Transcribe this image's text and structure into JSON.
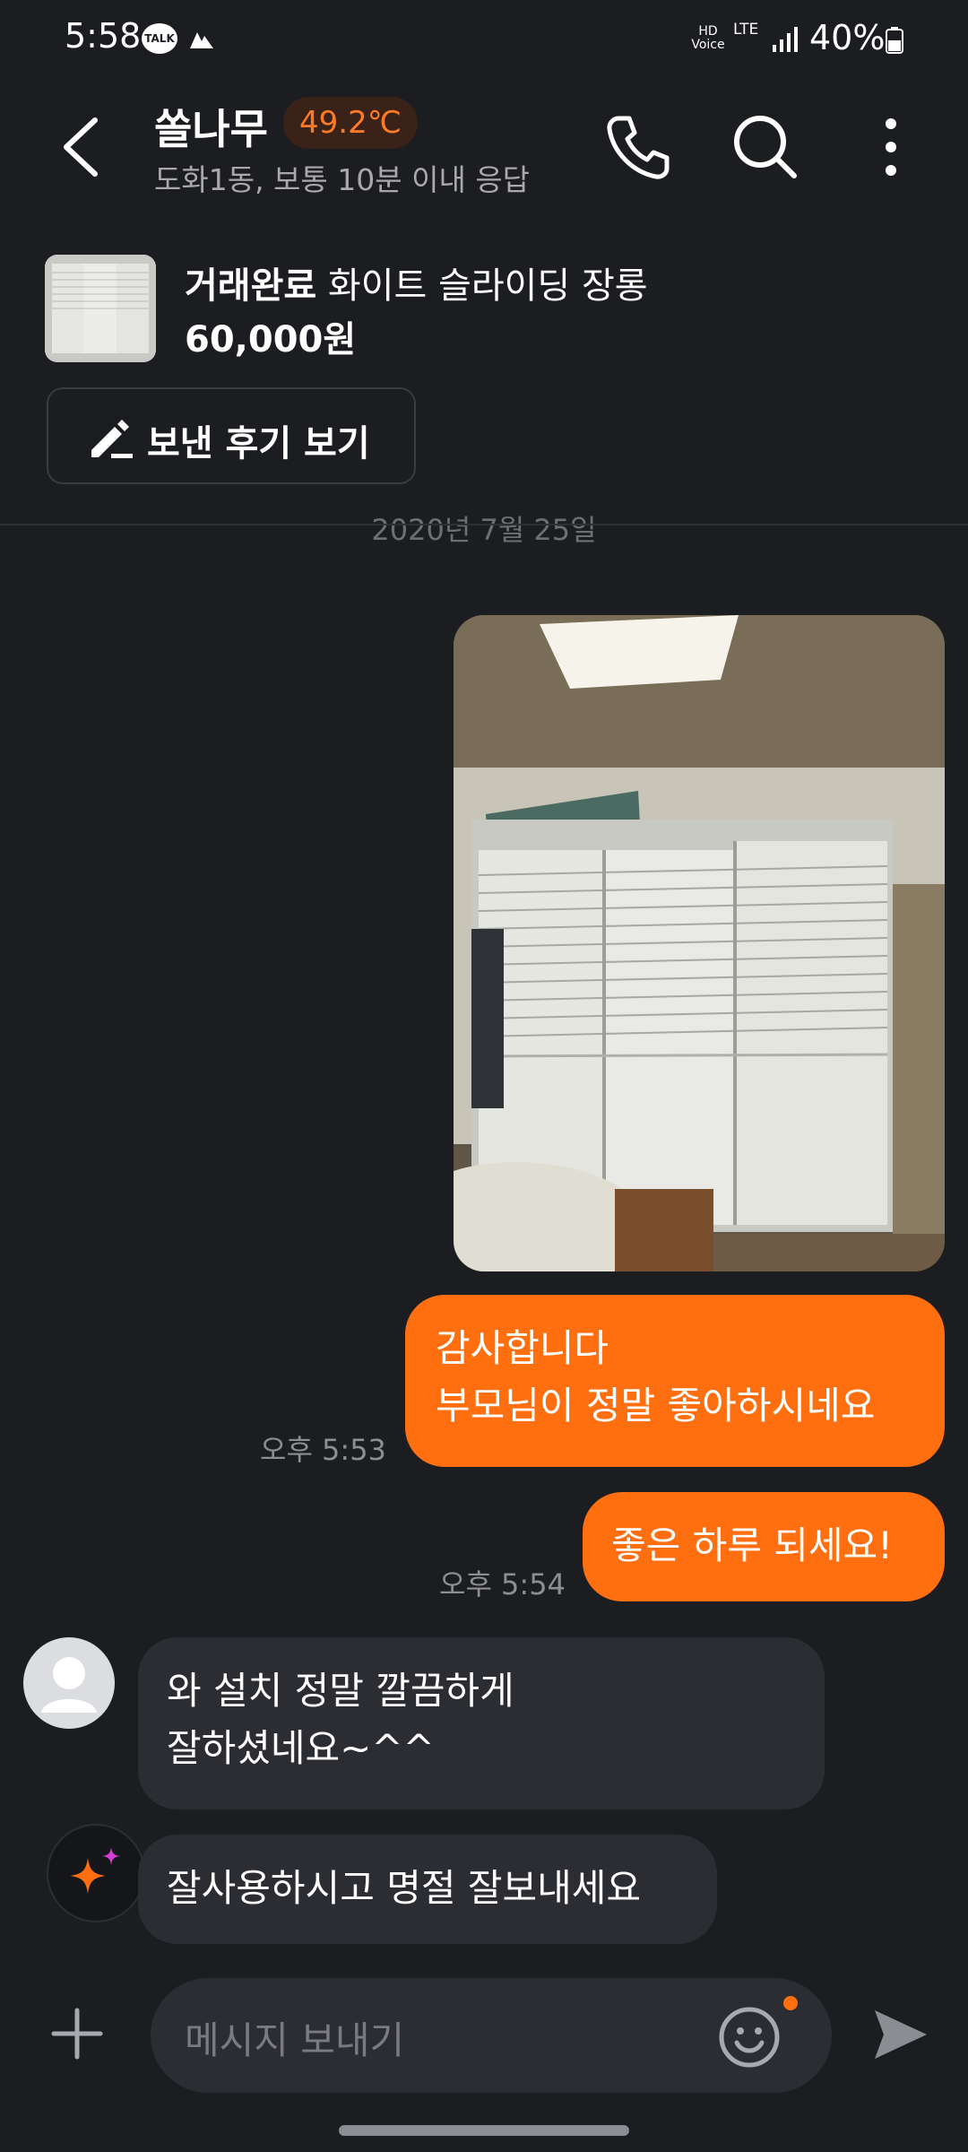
{
  "status_bar": {
    "time": "5:58",
    "talk_badge": "TALK",
    "hd_voice": "HD Voice",
    "lte": "LTE",
    "battery": "40%"
  },
  "header": {
    "title": "쏠나무",
    "temperature": "49.2℃",
    "subtitle": "도화1동, 보통 10분 이내 응답"
  },
  "product": {
    "status": "거래완료",
    "name": "화이트 슬라이딩 장롱",
    "price": "60,000원",
    "review_button": "보낸 후기 보기"
  },
  "chat": {
    "date_divider": "2020년 7월 25일",
    "messages": [
      {
        "side": "out",
        "type": "image"
      },
      {
        "side": "out",
        "lines": [
          "감사합니다",
          "부모님이 정말 좋아하시네요"
        ],
        "time": "오후 5:53"
      },
      {
        "side": "out",
        "lines": [
          "좋은 하루 되세요!"
        ],
        "time": "오후 5:54"
      },
      {
        "side": "in",
        "lines": [
          "와 설치 정말 깔끔하게",
          "잘하셨네요~^^"
        ]
      },
      {
        "side": "in",
        "lines": [
          "잘사용하시고 명절 잘보내세요"
        ]
      }
    ]
  },
  "input": {
    "placeholder": "메시지 보내기"
  },
  "colors": {
    "accent": "#ff6f0f",
    "background": "#1c1d21",
    "bubble_in": "#2c2d33"
  },
  "icons": [
    "back-icon",
    "phone-icon",
    "search-icon",
    "more-icon",
    "pencil-icon",
    "plus-icon",
    "emoji-icon",
    "send-icon",
    "sparkle-icon"
  ]
}
